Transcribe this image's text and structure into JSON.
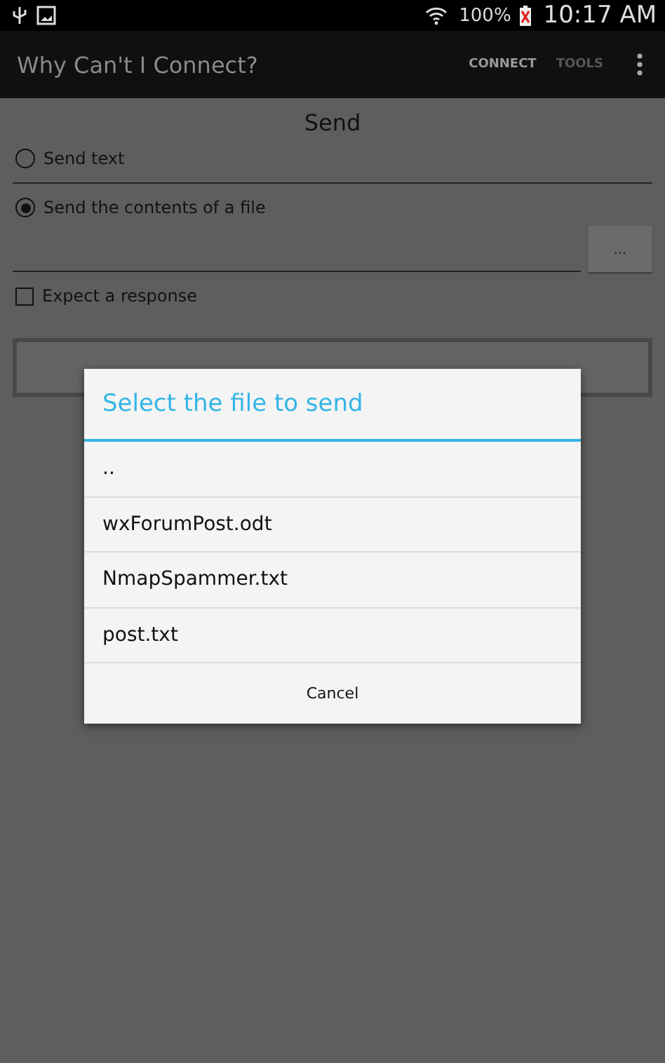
{
  "status_bar": {
    "battery": "100%",
    "time": "10:17 AM"
  },
  "action_bar": {
    "title": "Why Can't I Connect?",
    "actions": [
      {
        "label": "CONNECT",
        "selected": true
      },
      {
        "label": "TOOLS",
        "selected": false
      }
    ]
  },
  "form": {
    "heading": "Send",
    "options": [
      {
        "label": "Send text",
        "selected": false
      },
      {
        "label": "Send the contents of a file",
        "selected": true
      }
    ],
    "browse_button": "...",
    "expect_response": {
      "label": "Expect a response",
      "checked": false
    }
  },
  "dialog": {
    "title": "Select the file to send",
    "items": [
      "..",
      "wxForumPost.odt",
      "NmapSpammer.txt",
      "post.txt"
    ],
    "cancel": "Cancel"
  }
}
